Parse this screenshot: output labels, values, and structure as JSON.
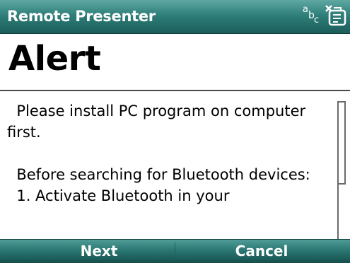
{
  "titlebar": {
    "app_title": "Remote Presenter",
    "input_mode": {
      "a": "a",
      "b": "b",
      "c": "c"
    },
    "status_icon": "sync-status-icon"
  },
  "alert": {
    "title": "Alert"
  },
  "message": {
    "line1": "  Please install PC program on computer",
    "line2": "first.",
    "line3": "  Before searching for Bluetooth devices:",
    "line4": "  1. Activate Bluetooth in your"
  },
  "softkeys": {
    "left_label": "Next",
    "right_label": "Cancel"
  },
  "colors": {
    "titlebar": "#2f7f7a",
    "softkeys": "#2a7773",
    "text": "#000000"
  }
}
